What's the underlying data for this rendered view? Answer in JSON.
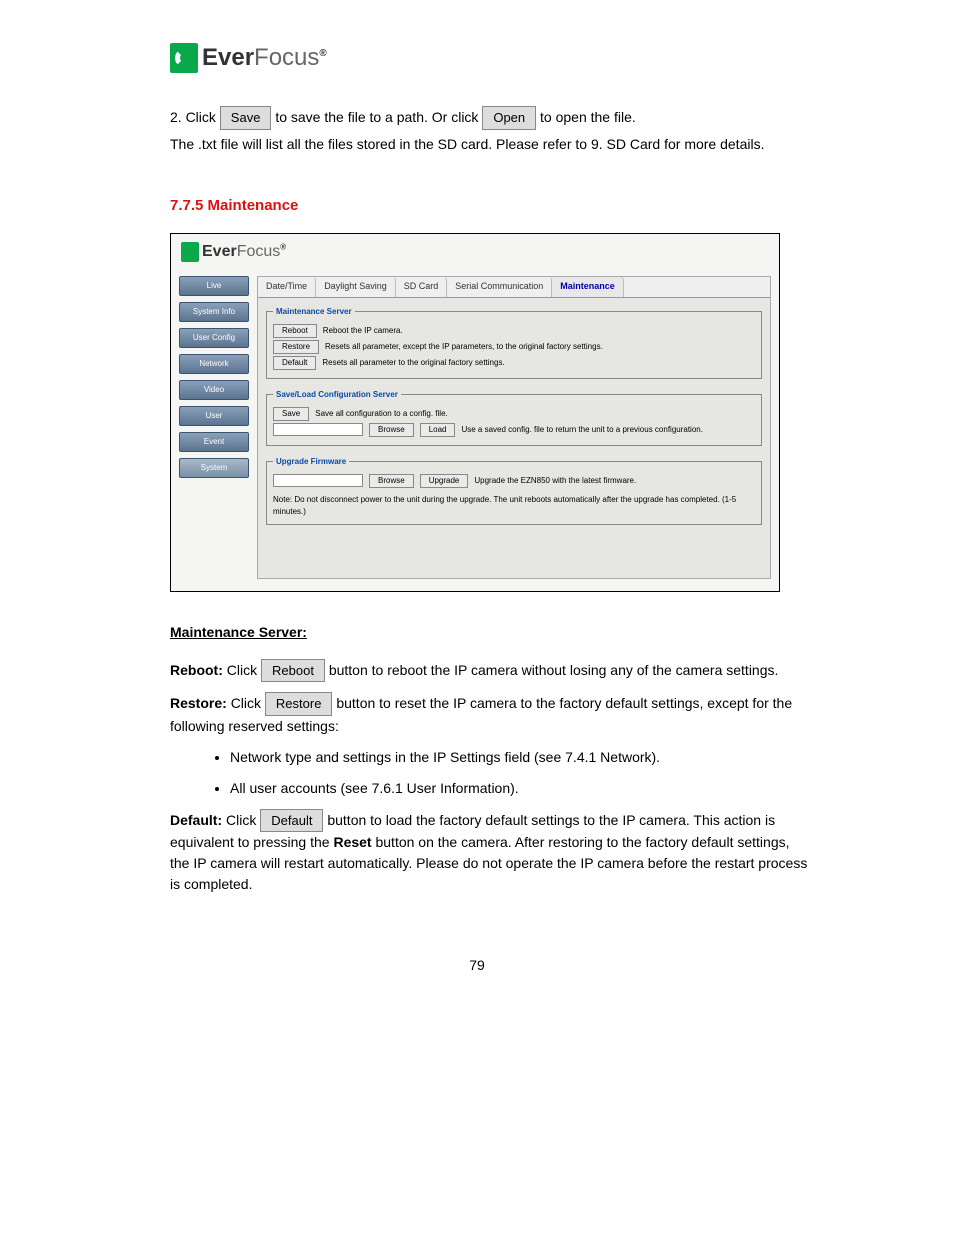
{
  "logo": {
    "brand_part1": "Ever",
    "brand_part2": "Focus",
    "sup": "®"
  },
  "intro": {
    "line1_a": "2. Click ",
    "line1_btn": "Save",
    "line1_b": " to save the file to a path. Or click ",
    "line1_btn2": "Open",
    "line1_c": " to open the file.",
    "line2": "The .txt file will list all the files stored in the SD card. Please refer to 9. SD Card for more details."
  },
  "section_title": "7.7.5 Maintenance",
  "screenshot": {
    "sidebar": [
      "Live",
      "System Info",
      "User Config",
      "Network",
      "Video",
      "User",
      "Event",
      "System"
    ],
    "tabs": [
      "Date/Time",
      "Daylight Saving",
      "SD Card",
      "Serial Communication",
      "Maintenance"
    ],
    "fs1": {
      "legend": "Maintenance Server",
      "reboot_btn": "Reboot",
      "reboot_txt": "Reboot the IP camera.",
      "restore_btn": "Restore",
      "restore_txt": "Resets all parameter, except the IP parameters, to the original factory settings.",
      "default_btn": "Default",
      "default_txt": "Resets all parameter to the original factory settings."
    },
    "fs2": {
      "legend": "Save/Load Configuration Server",
      "save_btn": "Save",
      "save_txt": "Save all configuration to a config. file.",
      "browse_btn": "Browse",
      "load_btn": "Load",
      "load_txt": "Use a saved config. file to return the unit to a previous configuration."
    },
    "fs3": {
      "legend": "Upgrade Firmware",
      "browse_btn": "Browse",
      "upgrade_btn": "Upgrade",
      "upgrade_txt": "Upgrade the EZN850 with the latest firmware.",
      "note": "Note: Do not disconnect power to the unit during the upgrade. The unit reboots automatically after the upgrade has completed. (1-5 minutes.)"
    }
  },
  "body": {
    "h_maint": "Maintenance Server:",
    "reboot_l": "Reboot:",
    "reboot_t": " Click ",
    "btn_reboot": "Reboot",
    "reboot_t2": " button to reboot the IP camera without losing any of the camera settings.",
    "restore_l": "Restore:",
    "restore_t": " Click ",
    "btn_restore": "Restore",
    "restore_t2": " button to reset the IP camera to the factory default settings, except for the following reserved settings:",
    "bullet1": "Network type and settings in the IP Settings field (see 7.4.1 Network).",
    "bullet2": "All user accounts (see 7.6.1 User Information).",
    "default_l": "Default:",
    "default_t": " Click ",
    "btn_default": "Default",
    "default_t2": " button to load the factory default settings to the IP camera. This action is equivalent to pressing the ",
    "default_t3_bold": "Reset",
    "default_t4": " button on the camera. After restoring to the factory default settings, the IP camera will restart automatically. Please do not operate the IP camera before the restart process is completed."
  },
  "page_num": "79"
}
